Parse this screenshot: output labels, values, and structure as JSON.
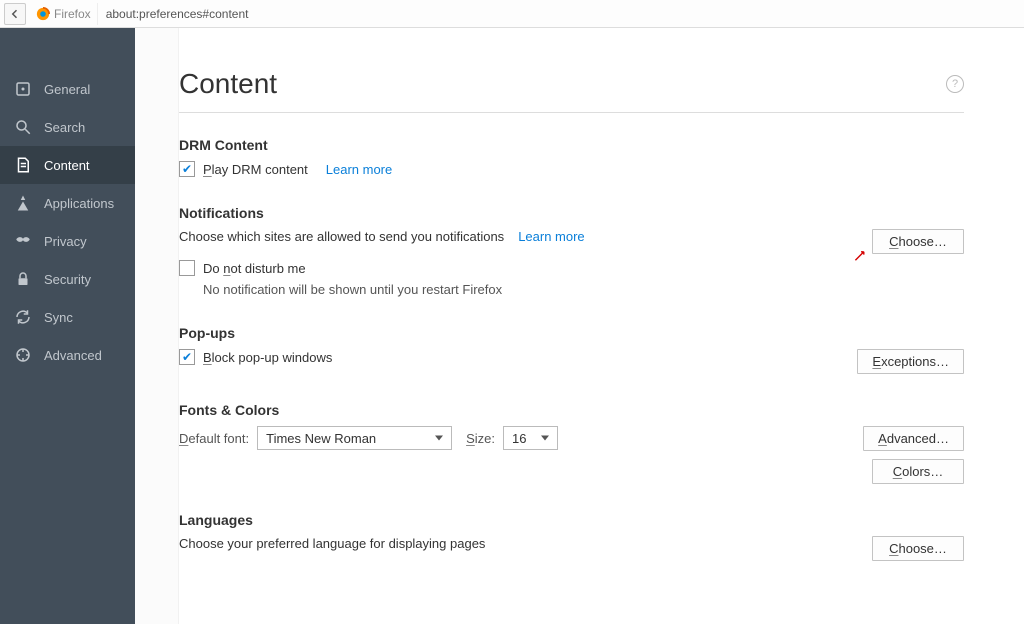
{
  "urlbar": {
    "brand": "Firefox",
    "url": "about:preferences#content"
  },
  "sidebar": {
    "items": [
      {
        "label": "General"
      },
      {
        "label": "Search"
      },
      {
        "label": "Content"
      },
      {
        "label": "Applications"
      },
      {
        "label": "Privacy"
      },
      {
        "label": "Security"
      },
      {
        "label": "Sync"
      },
      {
        "label": "Advanced"
      }
    ],
    "selected": 2
  },
  "page": {
    "title": "Content"
  },
  "drm": {
    "title": "DRM Content",
    "checkbox_a": "P",
    "checkbox_r": "lay DRM content",
    "learn_more": "Learn more"
  },
  "notifications": {
    "title": "Notifications",
    "desc": "Choose which sites are allowed to send you notifications",
    "learn_more": "Learn more",
    "choose_a": "C",
    "choose_r": "hoose…",
    "dnd_pre": "Do ",
    "dnd_a": "n",
    "dnd_post": "ot disturb me",
    "dnd_help": "No notification will be shown until you restart Firefox"
  },
  "popups": {
    "title": "Pop-ups",
    "checkbox_a": "B",
    "checkbox_r": "lock pop-up windows",
    "exceptions_a": "E",
    "exceptions_r": "xceptions…"
  },
  "fonts": {
    "title": "Fonts & Colors",
    "default_pre": "D",
    "default_post": "efault font:",
    "font_value": "Times New Roman",
    "size_a": "S",
    "size_r": "ize:",
    "size_value": "16",
    "advanced_a": "A",
    "advanced_r": "dvanced…",
    "colors_a": "C",
    "colors_r": "olors…"
  },
  "languages": {
    "title": "Languages",
    "desc": "Choose your preferred language for displaying pages",
    "choose_a": "C",
    "choose_r": "hoose…"
  }
}
